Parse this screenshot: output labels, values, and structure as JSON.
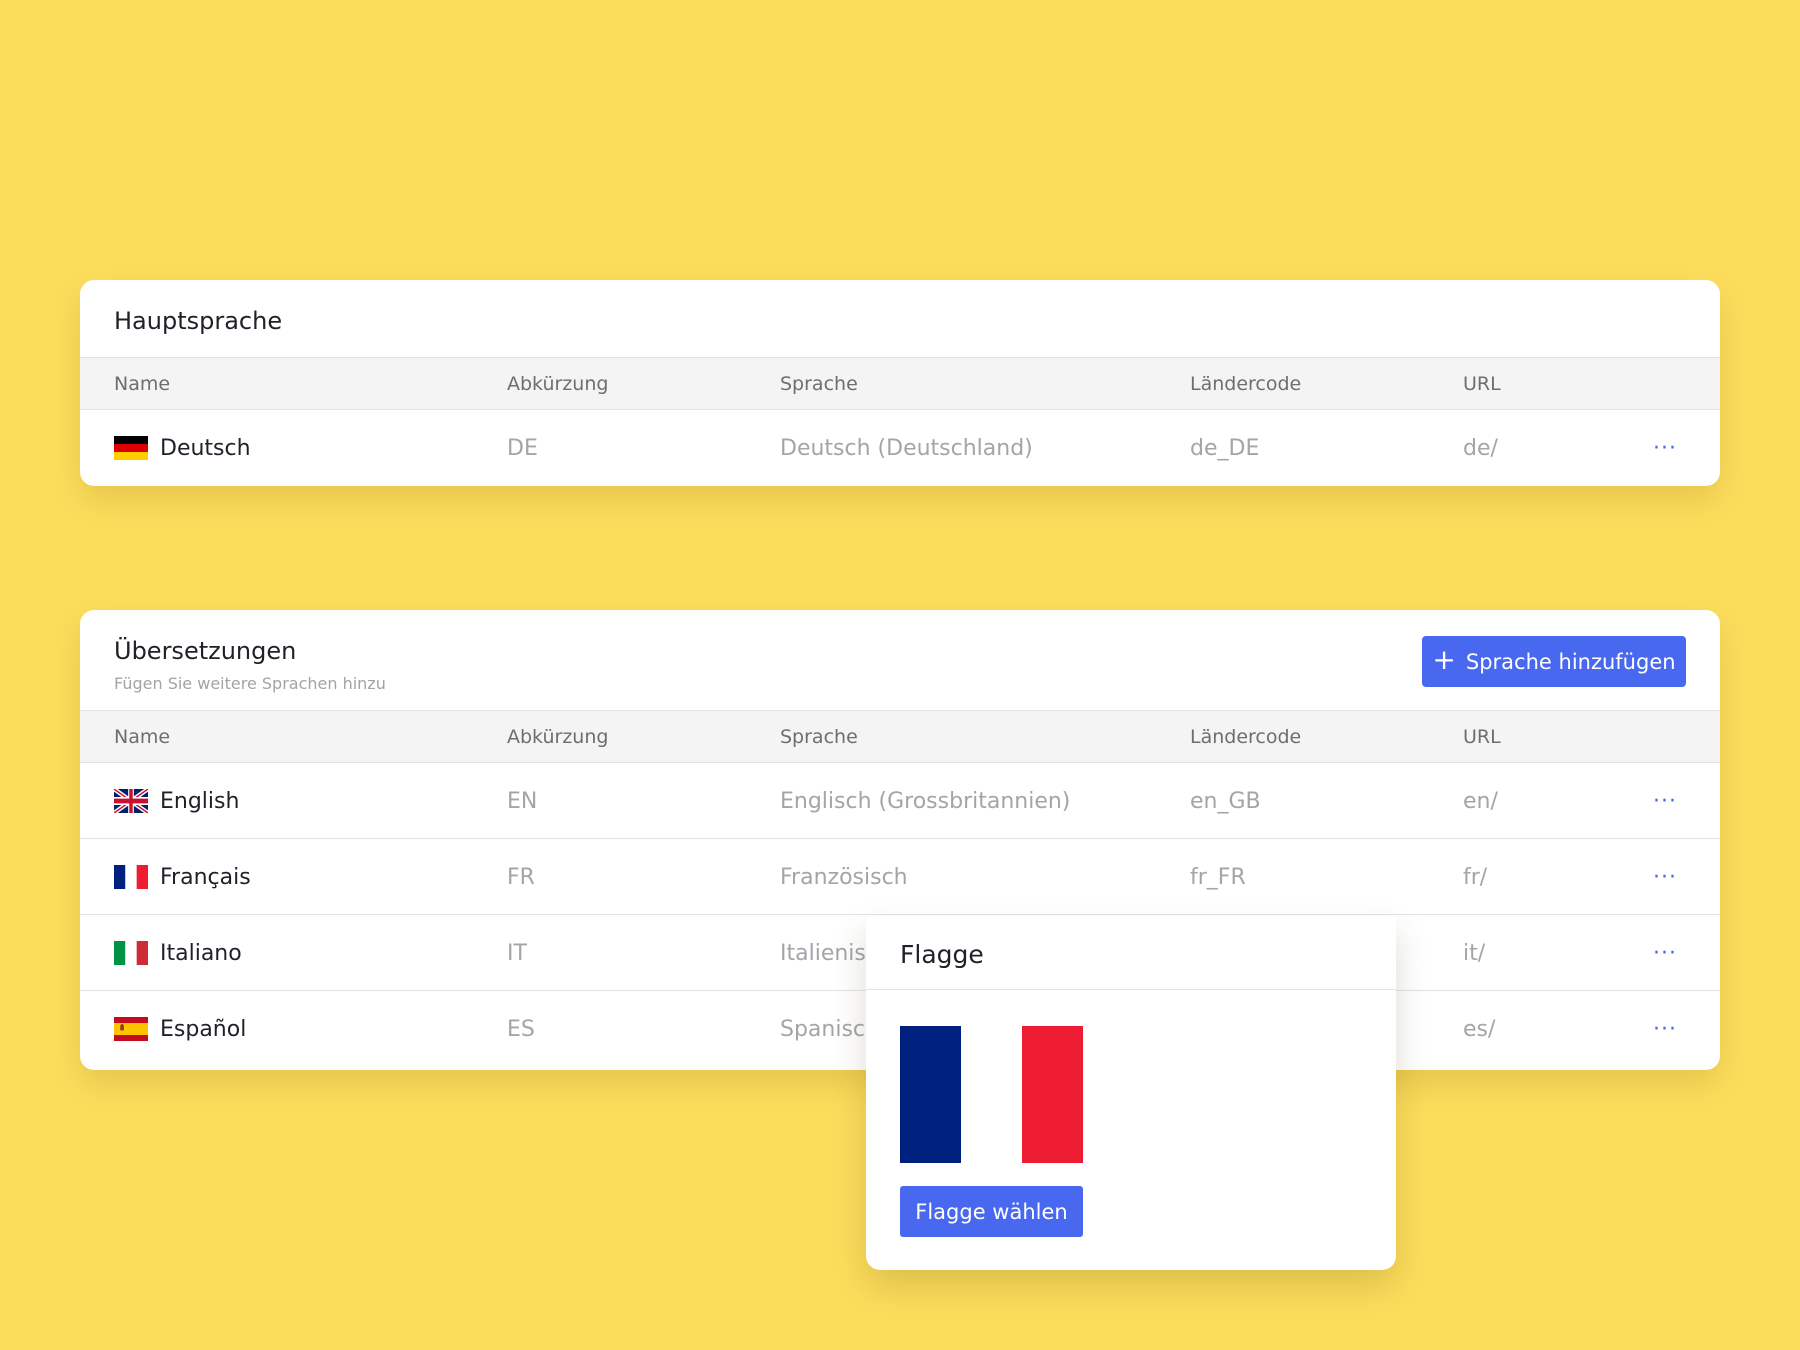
{
  "main_language": {
    "title": "Hauptsprache",
    "columns": [
      "Name",
      "Abkürzung",
      "Sprache",
      "Ländercode",
      "URL"
    ],
    "rows": [
      {
        "flag": "germany-flag-icon",
        "name": "Deutsch",
        "abbr": "DE",
        "language": "Deutsch (Deutschland)",
        "code": "de_DE",
        "url": "de/"
      }
    ]
  },
  "translations": {
    "title": "Übersetzungen",
    "subtitle": "Fügen Sie weitere Sprachen hinzu",
    "add_button": "Sprache hinzufügen",
    "add_icon": "+",
    "columns": [
      "Name",
      "Abkürzung",
      "Sprache",
      "Ländercode",
      "URL"
    ],
    "rows": [
      {
        "flag": "uk-flag-icon",
        "name": "English",
        "abbr": "EN",
        "language": "Englisch (Grossbritannien)",
        "code": "en_GB",
        "url": "en/"
      },
      {
        "flag": "france-flag-icon",
        "name": "Français",
        "abbr": "FR",
        "language": "Französisch",
        "code": "fr_FR",
        "url": "fr/"
      },
      {
        "flag": "italy-flag-icon",
        "name": "Italiano",
        "abbr": "IT",
        "language": "Italienisch",
        "code": "",
        "url": "it/"
      },
      {
        "flag": "spain-flag-icon",
        "name": "Español",
        "abbr": "ES",
        "language": "Spanisch",
        "code": "",
        "url": "es/"
      }
    ]
  },
  "more_icon": "···",
  "flag_popover": {
    "title": "Flagge",
    "preview": "france-flag-icon",
    "button": "Flagge wählen"
  },
  "colors": {
    "background": "#fcdd5b",
    "accent": "#4768ef",
    "france_blue": "#002080",
    "france_red": "#ed1c33"
  }
}
